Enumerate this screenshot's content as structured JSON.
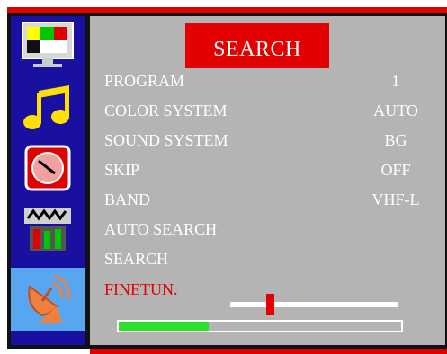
{
  "menu": {
    "title": "SEARCH",
    "rows": [
      {
        "label": "PROGRAM",
        "value": "1"
      },
      {
        "label": "COLOR SYSTEM",
        "value": "AUTO"
      },
      {
        "label": "SOUND SYSTEM",
        "value": "BG"
      },
      {
        "label": "SKIP",
        "value": "OFF"
      },
      {
        "label": "BAND",
        "value": "VHF-L"
      },
      {
        "label": "AUTO SEARCH",
        "value": ""
      },
      {
        "label": "SEARCH",
        "value": ""
      },
      {
        "label": "FINETUN.",
        "value": ""
      }
    ],
    "finetune_level": 0.24,
    "search_progress": 0.32
  },
  "sidebar": {
    "items": [
      {
        "icon": "tv-picture-icon"
      },
      {
        "icon": "music-note-icon"
      },
      {
        "icon": "clock-timer-icon"
      },
      {
        "icon": "equalizer-icon"
      },
      {
        "icon": "satellite-dish-icon",
        "active": true
      }
    ]
  },
  "colors": {
    "accent_red": "#e30000",
    "panel_gray": "#b4b4b4",
    "sidebar_blue": "#1a10a0",
    "active_blue": "#58a6f0",
    "progress_green": "#2ee02e"
  }
}
